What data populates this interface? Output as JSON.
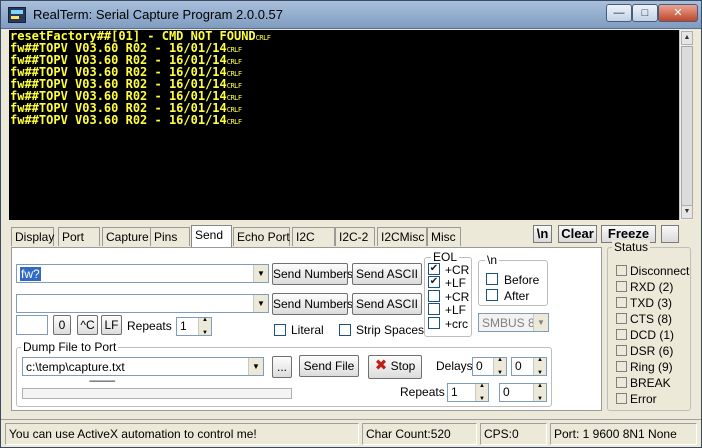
{
  "window": {
    "title": "RealTerm: Serial Capture Program 2.0.0.57",
    "min_glyph": "—",
    "max_glyph": "□",
    "close_glyph": "✕"
  },
  "terminal": {
    "lines": [
      {
        "text": "resetFactory##[01] - CMD NOT FOUND",
        "eol": "CRLF"
      },
      {
        "text": "fw##TOPV V03.60 R02 - 16/01/14",
        "eol": "CRLF"
      },
      {
        "text": "fw##TOPV V03.60 R02 - 16/01/14",
        "eol": "CRLF"
      },
      {
        "text": "fw##TOPV V03.60 R02 - 16/01/14",
        "eol": "CRLF"
      },
      {
        "text": "fw##TOPV V03.60 R02 - 16/01/14",
        "eol": "CRLF"
      },
      {
        "text": "fw##TOPV V03.60 R02 - 16/01/14",
        "eol": "CRLF"
      },
      {
        "text": "fw##TOPV V03.60 R02 - 16/01/14",
        "eol": "CRLF"
      },
      {
        "text": "fw##TOPV V03.60 R02 - 16/01/14",
        "eol": "CRLF"
      }
    ],
    "text_color": "#ffff40",
    "background": "#000000"
  },
  "tabs": [
    "Display",
    "Port",
    "Capture",
    "Pins",
    "Send",
    "Echo Port",
    "I2C",
    "I2C-2",
    "I2CMisc",
    "Misc"
  ],
  "active_tab": "Send",
  "toolbar": {
    "newline_label": "\\n",
    "clear_label": "Clear",
    "freeze_label": "Freeze"
  },
  "send": {
    "input1_value": "fw?",
    "input2_value": "",
    "send_numbers_label": "Send Numbers",
    "send_ascii_label": "Send ASCII",
    "small_value": "",
    "zero_label": "0",
    "ctrl_c_label": "^C",
    "lf_label": "LF",
    "repeats_label": "Repeats",
    "repeats_value": "1",
    "literal_label": "Literal",
    "strip_spaces_label": "Strip Spaces"
  },
  "eol": {
    "title": "EOL",
    "options": [
      {
        "label": "+CR",
        "checked": true
      },
      {
        "label": "+LF",
        "checked": true
      },
      {
        "label": "+CR",
        "checked": false
      },
      {
        "label": "+LF",
        "checked": false
      },
      {
        "label": "+crc",
        "checked": false
      }
    ]
  },
  "newline_group": {
    "title": "\\n",
    "before_label": "Before",
    "after_label": "After"
  },
  "smbus": {
    "value": "SMBUS 8"
  },
  "dump": {
    "title": "Dump File to Port",
    "path": "c:\\temp\\capture.txt",
    "browse_label": "...",
    "send_file_label": "Send File",
    "stop_label": "Stop",
    "delays_label": "Delays",
    "delay1": "0",
    "delay2": "0",
    "progress_text": "-----------",
    "repeats_label": "Repeats",
    "repeats1": "1",
    "repeats2": "0"
  },
  "status": {
    "title": "Status",
    "items": [
      "Disconnect",
      "RXD (2)",
      "TXD (3)",
      "CTS (8)",
      "DCD (1)",
      "DSR (6)",
      "Ring (9)",
      "BREAK",
      "Error"
    ]
  },
  "statusbar": {
    "message": "You can use ActiveX automation to control me!",
    "char_count": "Char Count:520",
    "cps": "CPS:0",
    "port": "Port: 1 9600 8N1 None"
  }
}
